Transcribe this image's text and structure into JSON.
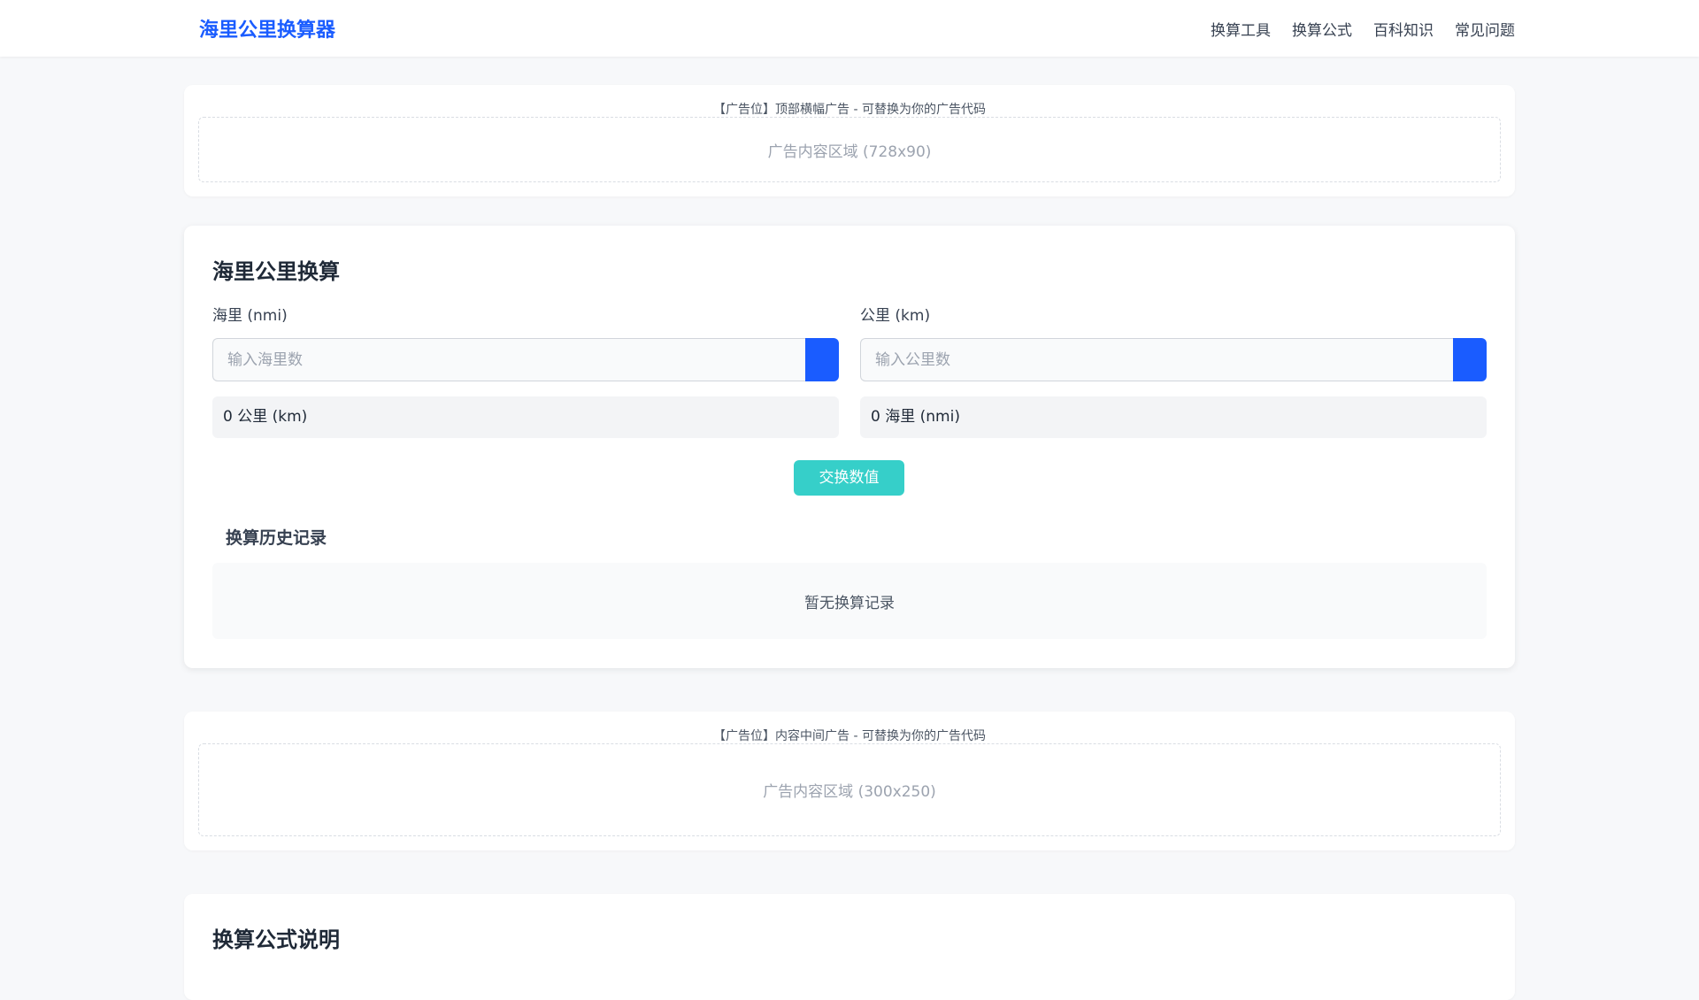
{
  "header": {
    "logo": "海里公里换算器",
    "nav": [
      "换算工具",
      "换算公式",
      "百科知识",
      "常见问题"
    ]
  },
  "ad_top": {
    "label": "【广告位】顶部横幅广告 - 可替换为你的广告代码",
    "content": "广告内容区域 (728x90)"
  },
  "converter": {
    "title": "海里公里换算",
    "nmi_label": "海里 (nmi)",
    "nmi_placeholder": "输入海里数",
    "nmi_result": "0 公里 (km)",
    "km_label": "公里 (km)",
    "km_placeholder": "输入公里数",
    "km_result": "0 海里 (nmi)",
    "swap_label": "交换数值",
    "history_title": "换算历史记录",
    "history_empty": "暂无换算记录"
  },
  "ad_mid": {
    "label": "【广告位】内容中间广告 - 可替换为你的广告代码",
    "content": "广告内容区域 (300x250)"
  },
  "formula": {
    "title": "换算公式说明"
  },
  "colors": {
    "brand": "#1a5cff",
    "swap": "#36cfc9"
  }
}
